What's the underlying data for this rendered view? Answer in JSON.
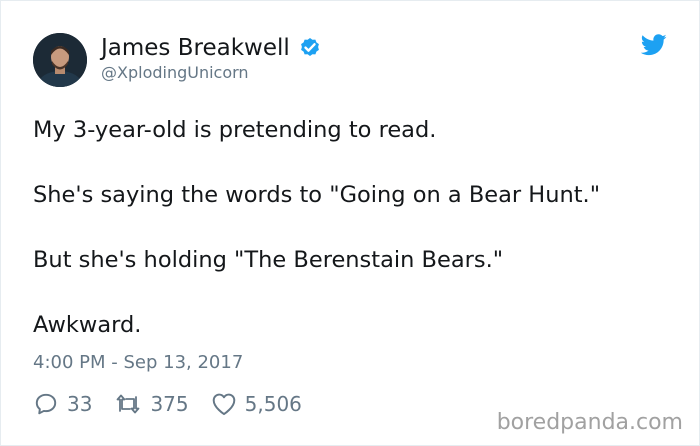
{
  "tweet": {
    "author_name": "James Breakwell",
    "handle": "@XplodingUnicorn",
    "lines": [
      "My 3-year-old is pretending to read.",
      "She's saying the words to \"Going on a Bear Hunt.\"",
      "But she's holding \"The Berenstain Bears.\"",
      "Awkward."
    ],
    "timestamp": "4:00 PM - Sep 13, 2017",
    "replies": "33",
    "retweets": "375",
    "likes": "5,506"
  },
  "watermark": "boredpanda.com",
  "icons": {
    "verified": "verified-badge-icon",
    "brand": "twitter-bird-icon",
    "reply": "reply-icon",
    "retweet": "retweet-icon",
    "like": "heart-icon"
  },
  "colors": {
    "twitter_blue": "#1da1f2",
    "text": "#14171a",
    "secondary": "#657786",
    "watermark": "#a1a1a1"
  }
}
